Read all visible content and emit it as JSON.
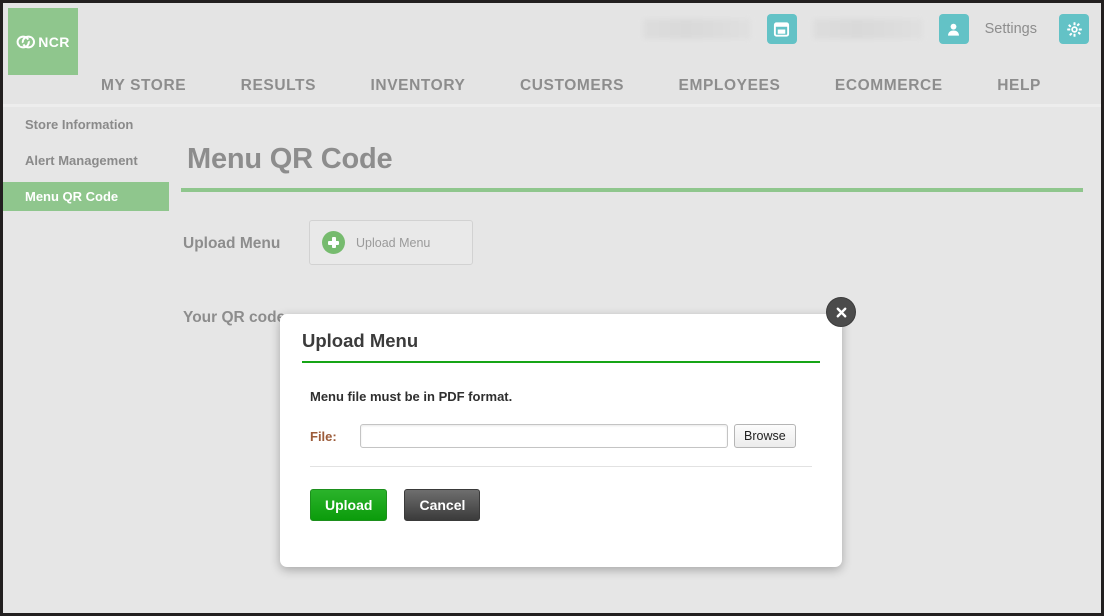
{
  "header": {
    "logo": {
      "text": "NCR",
      "icon": "ncr-rings-logo",
      "tile_color": "#8fc68d"
    },
    "redacted_store_label": "",
    "redacted_user_label": "",
    "store_icon": "store-icon",
    "user_icon": "user-icon",
    "settings_label": "Settings",
    "gear_icon": "gear-icon",
    "accent_color": "#63c2c6"
  },
  "nav": {
    "items": [
      {
        "label": "MY STORE"
      },
      {
        "label": "RESULTS"
      },
      {
        "label": "INVENTORY"
      },
      {
        "label": "CUSTOMERS"
      },
      {
        "label": "EMPLOYEES"
      },
      {
        "label": "ECOMMERCE"
      },
      {
        "label": "HELP"
      }
    ]
  },
  "sidebar": {
    "items": [
      {
        "label": "Store Information",
        "active": false
      },
      {
        "label": "Alert Management",
        "active": false
      },
      {
        "label": "Menu QR Code",
        "active": true
      }
    ],
    "active_bg": "#8fc68d"
  },
  "main": {
    "page_title": "Menu QR Code",
    "rule_color": "#8fc68d",
    "upload_menu_label": "Upload Menu",
    "upload_menu_button": {
      "label": "Upload Menu",
      "icon": "plus-circle-icon"
    },
    "qr_code_label": "Your QR code"
  },
  "modal": {
    "title": "Upload Menu",
    "title_rule_color": "#16a516",
    "note": "Menu file must be in PDF format.",
    "file_label": "File:",
    "file_value": "",
    "file_placeholder": "",
    "browse_label": "Browse",
    "upload_label": "Upload",
    "cancel_label": "Cancel",
    "close_icon": "close-icon"
  }
}
